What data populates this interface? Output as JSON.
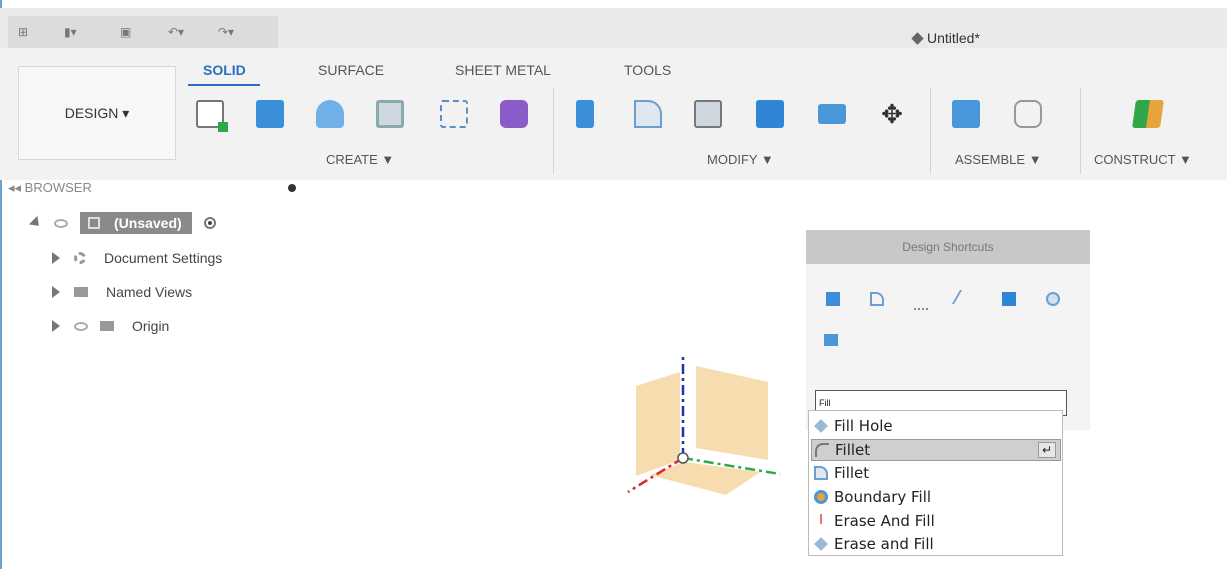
{
  "quick_access": {
    "grid": "⊞",
    "file": "▮▾",
    "save": "▣",
    "undo": "↶▾",
    "redo": "↷▾"
  },
  "document": {
    "title": "Untitled*"
  },
  "tabs": [
    "SOLID",
    "SURFACE",
    "SHEET METAL",
    "TOOLS"
  ],
  "workspace": {
    "label": "DESIGN ▾"
  },
  "groups": {
    "create": "CREATE ▼",
    "modify": "MODIFY ▼",
    "assemble": "ASSEMBLE ▼",
    "construct": "CONSTRUCT ▼"
  },
  "browser": {
    "header": "◂◂ BROWSER",
    "root": "(Unsaved)",
    "items": [
      "Document Settings",
      "Named Views",
      "Origin"
    ]
  },
  "shortcuts": {
    "title": "Design Shortcuts",
    "search_value": "Fill",
    "results": [
      "Fill Hole",
      "Fillet",
      "Fillet",
      "Boundary Fill",
      "Erase And Fill",
      "Erase and Fill"
    ],
    "enter_glyph": "↵"
  },
  "colors": {
    "accent": "#2a6fbf",
    "tool_blue": "#3b8fd9",
    "origin_plane": "#f6dcae"
  }
}
